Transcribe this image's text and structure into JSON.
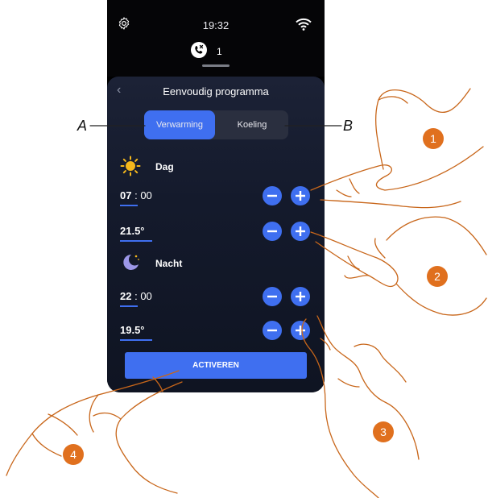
{
  "status_bar": {
    "time": "19:32",
    "call_count": "1"
  },
  "screen": {
    "title": "Eenvoudig programma",
    "tabs": [
      {
        "label": "Verwarming",
        "active": true
      },
      {
        "label": "Koeling",
        "active": false
      }
    ],
    "day": {
      "label": "Dag",
      "time_hour": "07",
      "time_sep": " : ",
      "time_min": "00",
      "temperature": "21.5°"
    },
    "night": {
      "label": "Nacht",
      "time_hour": "22",
      "time_sep": " : ",
      "time_min": "00",
      "temperature": "19.5°"
    },
    "activate_label": "ACTIVEREN"
  },
  "annotations": {
    "letters": [
      "A",
      "B"
    ],
    "callouts": [
      "1",
      "2",
      "3",
      "4"
    ]
  },
  "colors": {
    "accent": "#3f6ff0",
    "callout": "#e0701e",
    "hand_stroke": "#c8661a"
  }
}
